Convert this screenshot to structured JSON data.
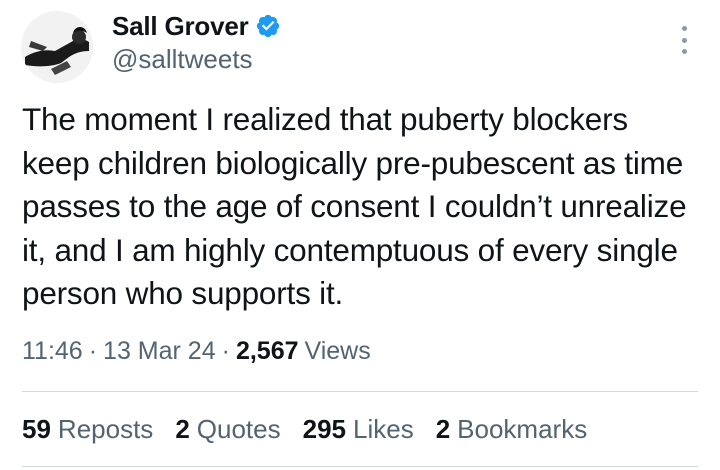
{
  "author": {
    "display_name": "Sall Grover",
    "handle": "@salltweets",
    "verified": true,
    "verified_color": "#1d9bf0",
    "avatar_icon": "profile-photo-black-white"
  },
  "tweet": {
    "text": "The moment I realized that puberty blockers keep children biologically pre-pubescent as time passes to the age of consent I couldn’t unrealize it, and I am highly contemptuous of every single person who supports it."
  },
  "meta": {
    "time": "11:46",
    "separator": "·",
    "date": "13 Mar 24",
    "views_count": "2,567",
    "views_label": "Views"
  },
  "stats": {
    "reposts_count": "59",
    "reposts_label": "Reposts",
    "quotes_count": "2",
    "quotes_label": "Quotes",
    "likes_count": "295",
    "likes_label": "Likes",
    "bookmarks_count": "2",
    "bookmarks_label": "Bookmarks"
  },
  "icons": {
    "more": "more-vertical-icon",
    "verified": "verified-badge-icon"
  }
}
